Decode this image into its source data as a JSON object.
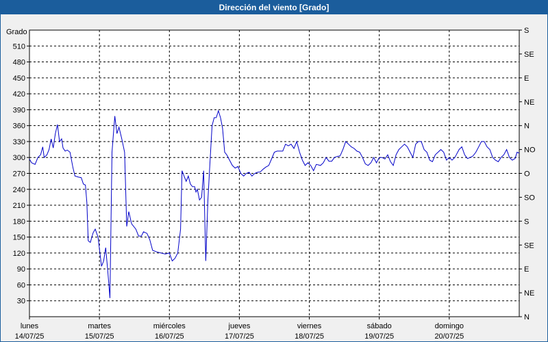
{
  "window": {
    "title": "Dirección del viento [Grado]"
  },
  "colors": {
    "title_bar": "#1b5d9c",
    "series": "#0000c8",
    "plot_bg": "#ffffff",
    "grid": "#000000"
  },
  "chart_data": {
    "type": "line",
    "title": "Dirección del viento [Grado]",
    "ylabel": "Grado",
    "ylim": [
      0,
      540
    ],
    "yticks": [
      30,
      60,
      90,
      120,
      150,
      180,
      210,
      240,
      270,
      300,
      330,
      360,
      390,
      420,
      450,
      480,
      510
    ],
    "right_axis_labels": [
      {
        "value": 0,
        "label": "N"
      },
      {
        "value": 45,
        "label": "NE"
      },
      {
        "value": 90,
        "label": "E"
      },
      {
        "value": 135,
        "label": "SE"
      },
      {
        "value": 180,
        "label": "S"
      },
      {
        "value": 225,
        "label": "SO"
      },
      {
        "value": 270,
        "label": "O"
      },
      {
        "value": 315,
        "label": "NO"
      },
      {
        "value": 360,
        "label": "N"
      },
      {
        "value": 405,
        "label": "NE"
      },
      {
        "value": 450,
        "label": "E"
      },
      {
        "value": 495,
        "label": "SE"
      },
      {
        "value": 540,
        "label": "S"
      }
    ],
    "xlim": [
      0,
      7
    ],
    "day_labels": [
      {
        "day": "lunes",
        "date": "14/07/25"
      },
      {
        "day": "martes",
        "date": "15/07/25"
      },
      {
        "day": "miércoles",
        "date": "16/07/25"
      },
      {
        "day": "jueves",
        "date": "17/07/25"
      },
      {
        "day": "viernes",
        "date": "18/07/25"
      },
      {
        "day": "sábado",
        "date": "19/07/25"
      },
      {
        "day": "domingo",
        "date": "20/07/25"
      }
    ],
    "grid": true,
    "series": [
      {
        "values": [
          [
            0.0,
            297
          ],
          [
            0.03,
            290
          ],
          [
            0.08,
            287
          ],
          [
            0.12,
            300
          ],
          [
            0.16,
            305
          ],
          [
            0.19,
            320
          ],
          [
            0.21,
            300
          ],
          [
            0.25,
            305
          ],
          [
            0.28,
            315
          ],
          [
            0.31,
            335
          ],
          [
            0.34,
            318
          ],
          [
            0.37,
            345
          ],
          [
            0.4,
            362
          ],
          [
            0.43,
            330
          ],
          [
            0.46,
            335
          ],
          [
            0.48,
            318
          ],
          [
            0.51,
            312
          ],
          [
            0.54,
            314
          ],
          [
            0.58,
            310
          ],
          [
            0.62,
            282
          ],
          [
            0.65,
            265
          ],
          [
            0.7,
            263
          ],
          [
            0.74,
            262
          ],
          [
            0.77,
            250
          ],
          [
            0.8,
            248
          ],
          [
            0.82,
            215
          ],
          [
            0.84,
            143
          ],
          [
            0.87,
            140
          ],
          [
            0.91,
            158
          ],
          [
            0.94,
            165
          ],
          [
            0.98,
            150
          ],
          [
            1.03,
            95
          ],
          [
            1.06,
            105
          ],
          [
            1.09,
            130
          ],
          [
            1.12,
            85
          ],
          [
            1.15,
            35
          ],
          [
            1.18,
            310
          ],
          [
            1.22,
            378
          ],
          [
            1.25,
            345
          ],
          [
            1.28,
            357
          ],
          [
            1.32,
            335
          ],
          [
            1.36,
            310
          ],
          [
            1.39,
            170
          ],
          [
            1.42,
            198
          ],
          [
            1.46,
            175
          ],
          [
            1.52,
            165
          ],
          [
            1.56,
            152
          ],
          [
            1.6,
            152
          ],
          [
            1.63,
            160
          ],
          [
            1.68,
            157
          ],
          [
            1.72,
            145
          ],
          [
            1.76,
            125
          ],
          [
            1.82,
            122
          ],
          [
            1.88,
            120
          ],
          [
            1.94,
            118
          ],
          [
            2.0,
            120
          ],
          [
            2.04,
            105
          ],
          [
            2.08,
            110
          ],
          [
            2.12,
            120
          ],
          [
            2.16,
            165
          ],
          [
            2.18,
            275
          ],
          [
            2.21,
            265
          ],
          [
            2.24,
            255
          ],
          [
            2.27,
            265
          ],
          [
            2.3,
            250
          ],
          [
            2.33,
            245
          ],
          [
            2.36,
            245
          ],
          [
            2.38,
            235
          ],
          [
            2.4,
            240
          ],
          [
            2.43,
            220
          ],
          [
            2.46,
            225
          ],
          [
            2.49,
            275
          ],
          [
            2.52,
            105
          ],
          [
            2.55,
            220
          ],
          [
            2.58,
            290
          ],
          [
            2.61,
            360
          ],
          [
            2.64,
            375
          ],
          [
            2.67,
            375
          ],
          [
            2.7,
            388
          ],
          [
            2.73,
            375
          ],
          [
            2.76,
            355
          ],
          [
            2.79,
            310
          ],
          [
            2.82,
            305
          ],
          [
            2.86,
            295
          ],
          [
            2.9,
            285
          ],
          [
            2.94,
            280
          ],
          [
            2.98,
            283
          ],
          [
            3.02,
            270
          ],
          [
            3.06,
            265
          ],
          [
            3.1,
            270
          ],
          [
            3.14,
            272
          ],
          [
            3.18,
            265
          ],
          [
            3.22,
            270
          ],
          [
            3.26,
            272
          ],
          [
            3.3,
            273
          ],
          [
            3.34,
            278
          ],
          [
            3.38,
            282
          ],
          [
            3.42,
            285
          ],
          [
            3.46,
            297
          ],
          [
            3.5,
            310
          ],
          [
            3.54,
            312
          ],
          [
            3.58,
            312
          ],
          [
            3.62,
            312
          ],
          [
            3.66,
            325
          ],
          [
            3.7,
            322
          ],
          [
            3.74,
            325
          ],
          [
            3.78,
            317
          ],
          [
            3.82,
            330
          ],
          [
            3.86,
            310
          ],
          [
            3.9,
            295
          ],
          [
            3.94,
            285
          ],
          [
            3.98,
            290
          ],
          [
            4.02,
            285
          ],
          [
            4.06,
            275
          ],
          [
            4.1,
            287
          ],
          [
            4.16,
            285
          ],
          [
            4.2,
            290
          ],
          [
            4.24,
            300
          ],
          [
            4.28,
            293
          ],
          [
            4.32,
            293
          ],
          [
            4.36,
            300
          ],
          [
            4.4,
            302
          ],
          [
            4.44,
            303
          ],
          [
            4.48,
            315
          ],
          [
            4.52,
            330
          ],
          [
            4.56,
            325
          ],
          [
            4.6,
            320
          ],
          [
            4.64,
            317
          ],
          [
            4.68,
            312
          ],
          [
            4.72,
            310
          ],
          [
            4.76,
            300
          ],
          [
            4.8,
            288
          ],
          [
            4.84,
            285
          ],
          [
            4.88,
            290
          ],
          [
            4.92,
            300
          ],
          [
            4.96,
            290
          ],
          [
            5.0,
            300
          ],
          [
            5.04,
            300
          ],
          [
            5.08,
            297
          ],
          [
            5.12,
            305
          ],
          [
            5.16,
            292
          ],
          [
            5.2,
            285
          ],
          [
            5.24,
            305
          ],
          [
            5.28,
            315
          ],
          [
            5.32,
            320
          ],
          [
            5.36,
            325
          ],
          [
            5.4,
            320
          ],
          [
            5.44,
            310
          ],
          [
            5.48,
            300
          ],
          [
            5.52,
            325
          ],
          [
            5.56,
            330
          ],
          [
            5.6,
            330
          ],
          [
            5.64,
            315
          ],
          [
            5.68,
            310
          ],
          [
            5.72,
            295
          ],
          [
            5.76,
            292
          ],
          [
            5.8,
            305
          ],
          [
            5.84,
            310
          ],
          [
            5.88,
            315
          ],
          [
            5.92,
            310
          ],
          [
            5.96,
            295
          ],
          [
            6.0,
            300
          ],
          [
            6.04,
            295
          ],
          [
            6.08,
            300
          ],
          [
            6.1,
            305
          ],
          [
            6.14,
            315
          ],
          [
            6.18,
            320
          ],
          [
            6.22,
            305
          ],
          [
            6.26,
            298
          ],
          [
            6.3,
            300
          ],
          [
            6.34,
            303
          ],
          [
            6.38,
            310
          ],
          [
            6.42,
            320
          ],
          [
            6.46,
            330
          ],
          [
            6.5,
            330
          ],
          [
            6.54,
            320
          ],
          [
            6.58,
            315
          ],
          [
            6.62,
            300
          ],
          [
            6.66,
            295
          ],
          [
            6.7,
            292
          ],
          [
            6.74,
            300
          ],
          [
            6.78,
            305
          ],
          [
            6.82,
            315
          ],
          [
            6.86,
            300
          ],
          [
            6.9,
            295
          ],
          [
            6.94,
            298
          ],
          [
            6.97,
            310
          ],
          [
            7.0,
            308
          ]
        ]
      }
    ]
  }
}
